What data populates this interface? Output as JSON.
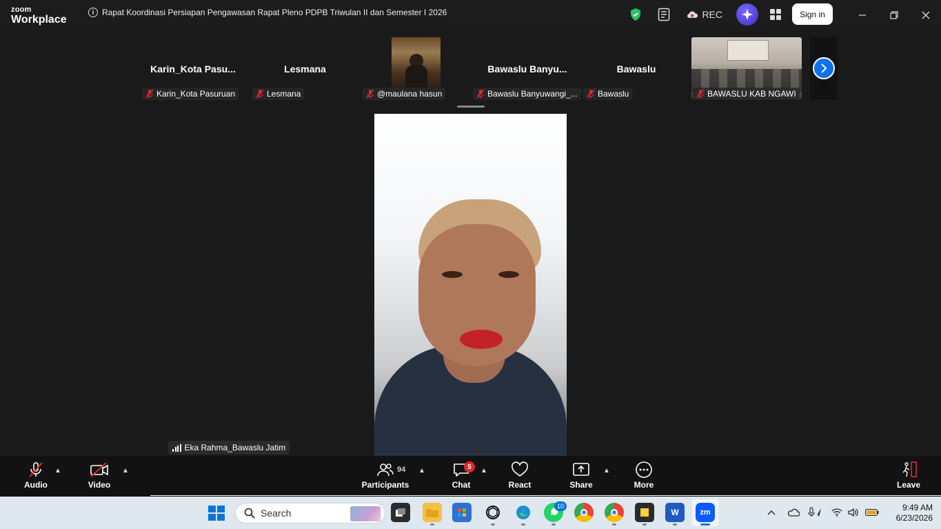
{
  "titlebar": {
    "logo_top": "zoom",
    "logo_bottom": "Workplace",
    "meeting_title": "Rapat Koordinasi Persiapan Pengawasan Rapat Pleno PDPB Triwulan II dan Semester I 2026",
    "rec_label": "REC",
    "sign_in_label": "Sign in"
  },
  "participants_strip": [
    {
      "name": "Karin_Kota  Pasu...",
      "label": "Karin_Kota Pasuruan",
      "muted": true
    },
    {
      "name": "Lesmana",
      "label": "Lesmana",
      "muted": true
    },
    {
      "name": "",
      "label": "@maulana hasun",
      "muted": true,
      "has_video": true
    },
    {
      "name": "Bawaslu  Banyu...",
      "label": "Bawaslu Banyuwangi_...",
      "muted": true
    },
    {
      "name": "Bawaslu",
      "label": "Bawaslu",
      "muted": true
    },
    {
      "name": "",
      "label": "BAWASLU KAB NGAWI",
      "muted": true,
      "has_video": true
    }
  ],
  "active_speaker": {
    "label": "Eka Rahma_Bawaslu Jatim"
  },
  "toolbar": {
    "audio_label": "Audio",
    "video_label": "Video",
    "participants_label": "Participants",
    "participants_count": "94",
    "chat_label": "Chat",
    "chat_badge": "5",
    "react_label": "React",
    "share_label": "Share",
    "more_label": "More",
    "leave_label": "Leave"
  },
  "taskbar": {
    "search_placeholder": "Search",
    "whatsapp_badge": "10",
    "time": "9:49 AM",
    "date": "6/23/2026"
  },
  "colors": {
    "accent_blue": "#0e72ed",
    "mute_red": "#e02828",
    "shield_green": "#22c55e"
  }
}
